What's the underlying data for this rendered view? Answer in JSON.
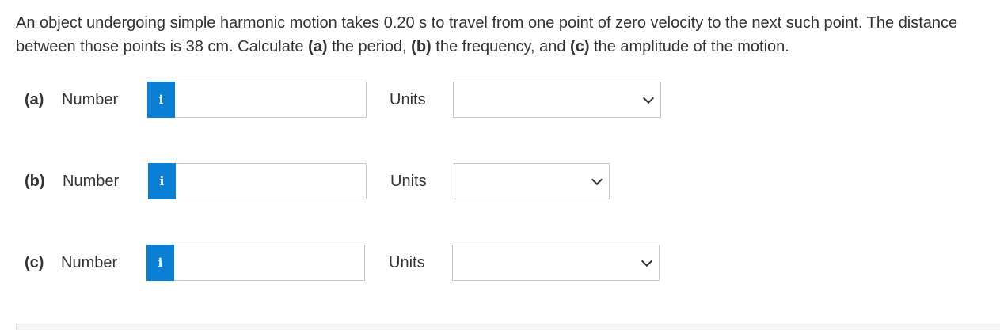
{
  "question": {
    "intro": "An object undergoing simple harmonic motion takes 0.20 s to travel from one point of zero velocity to the next such point. The distance between those points is 38 cm. Calculate ",
    "part_a_ref": "(a)",
    "part_a_text": " the period, ",
    "part_b_ref": "(b)",
    "part_b_text": " the frequency, and ",
    "part_c_ref": "(c)",
    "part_c_text": " the amplitude of the motion."
  },
  "parts": [
    {
      "label": "(a)",
      "number_label": "Number",
      "info_icon": "i",
      "input_value": "",
      "units_label": "Units",
      "units_value": ""
    },
    {
      "label": "(b)",
      "number_label": "Number",
      "info_icon": "i",
      "input_value": "",
      "units_label": "Units",
      "units_value": ""
    },
    {
      "label": "(c)",
      "number_label": "Number",
      "info_icon": "i",
      "input_value": "",
      "units_label": "Units",
      "units_value": ""
    }
  ],
  "colors": {
    "info_button": "#0b7fd3",
    "text": "#333333",
    "border": "#c8c8c8"
  }
}
